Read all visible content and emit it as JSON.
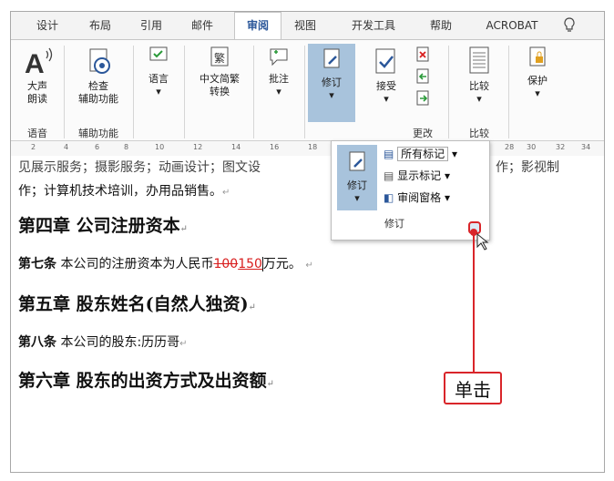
{
  "tabs": [
    "设计",
    "布局",
    "引用",
    "邮件",
    "审阅",
    "视图",
    "开发工具",
    "帮助",
    "ACROBAT"
  ],
  "active_tab": "审阅",
  "ribbon": {
    "read_aloud": "大声\n朗读",
    "accessibility": "检查\n辅助功能",
    "language": "语言",
    "chinese_convert": "中文简繁\n转换",
    "comment": "批注",
    "track": "修订",
    "accept": "接受",
    "compare": "比较",
    "protect": "保护",
    "groups": {
      "speech": "语音",
      "accessibility": "辅助功能",
      "changes": "更改",
      "compare": "比较"
    }
  },
  "ruler_ticks": [
    "2",
    "4",
    "6",
    "8",
    "10",
    "12",
    "14",
    "16",
    "18",
    "28",
    "30",
    "32",
    "34"
  ],
  "popup": {
    "track_label": "修订",
    "all_markup": "所有标记",
    "show_markup": "显示标记",
    "review_pane": "审阅窗格",
    "group_label": "修订"
  },
  "doc": {
    "line0_left": "见展示服务；摄影服务；动画设计；图文设",
    "line0_right": "作；影视制",
    "line1": "作；计算机技术培训，办用品销售。",
    "ch4": "第四章  公司注册资本",
    "art7_label": "第七条",
    "art7_text": "本公司的注册资本为人民币",
    "art7_del": "100",
    "art7_ins": "150",
    "art7_end": "万元。",
    "ch5": "第五章  股东姓名(自然人独资)",
    "art8_label": "第八条",
    "art8_text": "本公司的股东:历历哥",
    "ch6": "第六章  股东的出资方式及出资额"
  },
  "callout": "单击",
  "colors": {
    "accent": "#2b579a",
    "highlight": "#a8c3dc",
    "callout": "#d9252a"
  }
}
